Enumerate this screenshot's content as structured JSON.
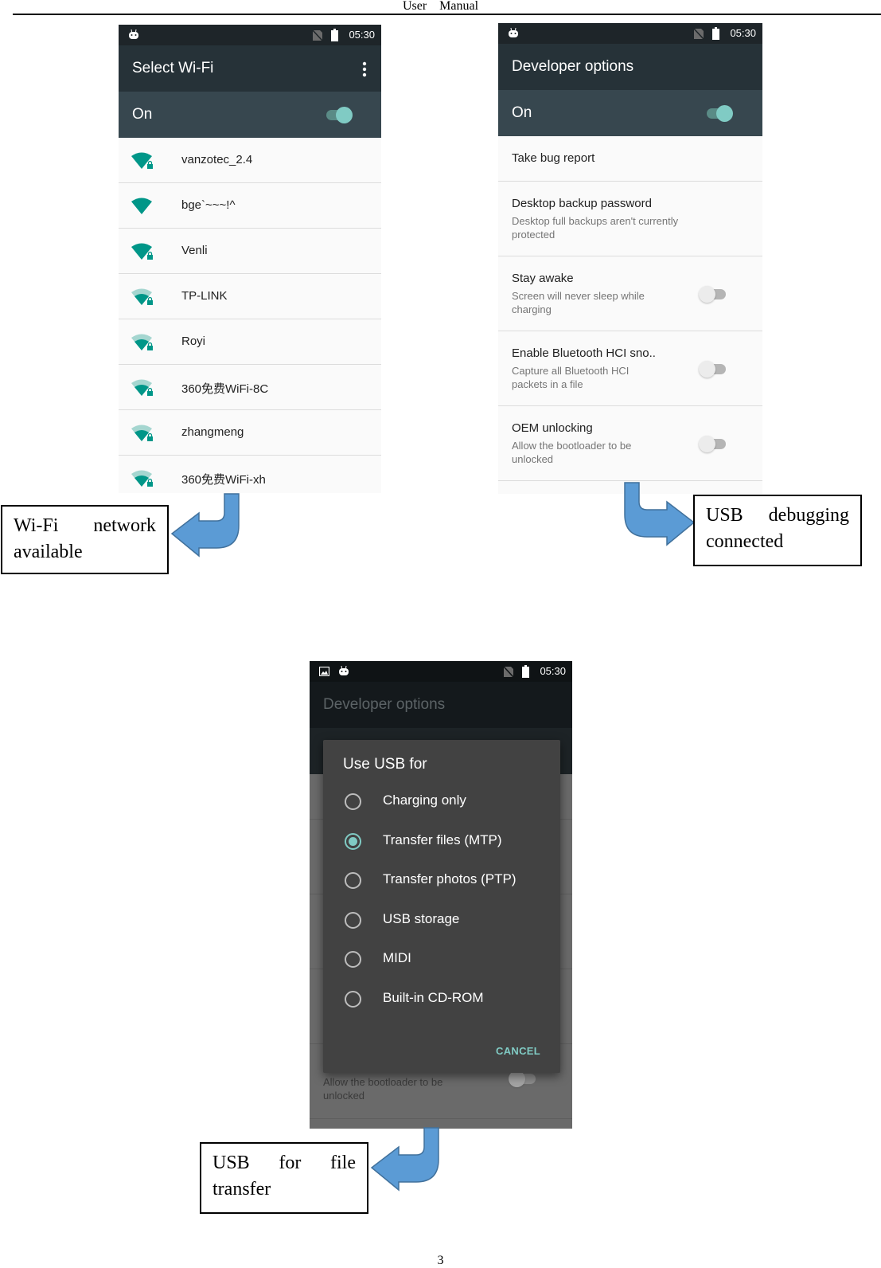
{
  "document": {
    "header": "User    Manual",
    "page_number": "3"
  },
  "colors": {
    "accent": "#80cbc4",
    "wifi_icon": "#009688",
    "app_bar": "#263238",
    "switch_bar": "#37474f",
    "callout_arrow": "#5b9bd5"
  },
  "wifi_screen": {
    "status_time": "05:30",
    "title": "Select Wi-Fi",
    "switch_label": "On",
    "switch_on": true,
    "networks": [
      {
        "ssid": "vanzotec_2.4",
        "signal": "full",
        "secured": true
      },
      {
        "ssid": "bge`~~~!^",
        "signal": "full",
        "secured": false
      },
      {
        "ssid": "Venli",
        "signal": "full",
        "secured": true
      },
      {
        "ssid": "TP-LINK",
        "signal": "medium",
        "secured": true
      },
      {
        "ssid": "Royi",
        "signal": "medium",
        "secured": true
      },
      {
        "ssid": "360免费WiFi-8C",
        "signal": "medium",
        "secured": true
      },
      {
        "ssid": "zhangmeng",
        "signal": "medium",
        "secured": true
      },
      {
        "ssid": "360免费WiFi-xh",
        "signal": "medium",
        "secured": true
      }
    ]
  },
  "developer_screen": {
    "status_time": "05:30",
    "title": "Developer options",
    "switch_label": "On",
    "switch_on": true,
    "items": [
      {
        "title": "Take bug report",
        "summary": ""
      },
      {
        "title": "Desktop backup password",
        "summary": "Desktop full backups aren't currently protected"
      },
      {
        "title": "Stay awake",
        "summary": "Screen will never sleep while charging",
        "toggle": false
      },
      {
        "title": "Enable Bluetooth HCI sno..",
        "summary": "Capture all Bluetooth HCI packets in a file",
        "toggle": false
      },
      {
        "title": "OEM unlocking",
        "summary": "Allow the bootloader to be unlocked",
        "toggle": false
      }
    ]
  },
  "usb_screen": {
    "status_time": "05:30",
    "background_title": "Developer options",
    "background_summary": "Allow the bootloader to be unlocked",
    "dialog": {
      "title": "Use USB for",
      "options": [
        {
          "label": "Charging only",
          "selected": false
        },
        {
          "label": "Transfer files (MTP)",
          "selected": true
        },
        {
          "label": "Transfer photos (PTP)",
          "selected": false
        },
        {
          "label": "USB storage",
          "selected": false
        },
        {
          "label": "MIDI",
          "selected": false
        },
        {
          "label": "Built-in CD-ROM",
          "selected": false
        }
      ],
      "cancel_label": "CANCEL"
    }
  },
  "callouts": {
    "wifi": {
      "line1_a": "Wi-Fi",
      "line1_b": "network",
      "line2": "available"
    },
    "usb_debugging": {
      "line1_a": "USB",
      "line1_b": "debugging",
      "line2": "connected"
    },
    "usb_transfer": {
      "line1_a": "USB",
      "line1_b": "for",
      "line1_c": "file",
      "line2": "transfer"
    }
  }
}
